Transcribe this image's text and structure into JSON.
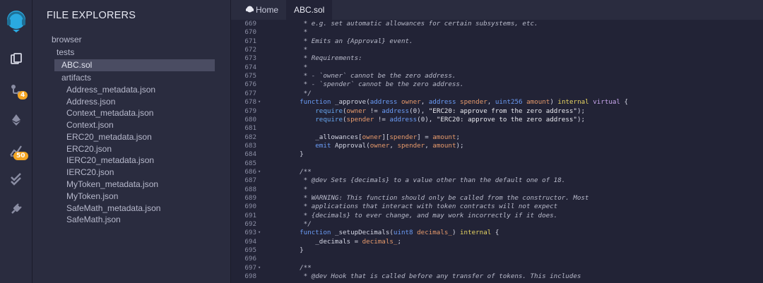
{
  "sidebar": {
    "title": "FILE EXPLORERS",
    "items": [
      {
        "label": "browser"
      },
      {
        "label": "tests"
      },
      {
        "label": "ABC.sol"
      },
      {
        "label": "artifacts"
      },
      {
        "label": "Address_metadata.json"
      },
      {
        "label": "Address.json"
      },
      {
        "label": "Context_metadata.json"
      },
      {
        "label": "Context.json"
      },
      {
        "label": "ERC20_metadata.json"
      },
      {
        "label": "ERC20.json"
      },
      {
        "label": "IERC20_metadata.json"
      },
      {
        "label": "IERC20.json"
      },
      {
        "label": "MyToken_metadata.json"
      },
      {
        "label": "MyToken.json"
      },
      {
        "label": "SafeMath_metadata.json"
      },
      {
        "label": "SafeMath.json"
      }
    ]
  },
  "rail": {
    "badges": {
      "git": "4",
      "analysis": "50"
    },
    "icons": [
      "remix-logo-icon",
      "files-icon",
      "git-icon",
      "deploy-icon",
      "analysis-icon",
      "check-icon",
      "plugin-icon"
    ]
  },
  "tabs": [
    {
      "label": "Home",
      "icon": "remix-home-icon"
    },
    {
      "label": "ABC.sol"
    }
  ],
  "editor": {
    "lines": [
      {
        "n": "669",
        "t": "     * e.g. set automatic allowances for certain subsystems, etc."
      },
      {
        "n": "670",
        "t": "     *"
      },
      {
        "n": "671",
        "t": "     * Emits an {Approval} event."
      },
      {
        "n": "672",
        "t": "     *"
      },
      {
        "n": "673",
        "t": "     * Requirements:"
      },
      {
        "n": "674",
        "t": "     *"
      },
      {
        "n": "675",
        "t": "     * - `owner` cannot be the zero address."
      },
      {
        "n": "676",
        "t": "     * - `spender` cannot be the zero address."
      },
      {
        "n": "677",
        "t": "     */"
      },
      {
        "n": "678",
        "t": "    function _approve(address owner, address spender, uint256 amount) internal virtual {",
        "fold": true
      },
      {
        "n": "679",
        "t": "        require(owner != address(0), \"ERC20: approve from the zero address\");"
      },
      {
        "n": "680",
        "t": "        require(spender != address(0), \"ERC20: approve to the zero address\");"
      },
      {
        "n": "681",
        "t": ""
      },
      {
        "n": "682",
        "t": "        _allowances[owner][spender] = amount;"
      },
      {
        "n": "683",
        "t": "        emit Approval(owner, spender, amount);"
      },
      {
        "n": "684",
        "t": "    }"
      },
      {
        "n": "685",
        "t": ""
      },
      {
        "n": "686",
        "t": "    /**",
        "fold": true
      },
      {
        "n": "687",
        "t": "     * @dev Sets {decimals} to a value other than the default one of 18."
      },
      {
        "n": "688",
        "t": "     *"
      },
      {
        "n": "689",
        "t": "     * WARNING: This function should only be called from the constructor. Most"
      },
      {
        "n": "690",
        "t": "     * applications that interact with token contracts will not expect"
      },
      {
        "n": "691",
        "t": "     * {decimals} to ever change, and may work incorrectly if it does."
      },
      {
        "n": "692",
        "t": "     */"
      },
      {
        "n": "693",
        "t": "    function _setupDecimals(uint8 decimals_) internal {",
        "fold": true
      },
      {
        "n": "694",
        "t": "        _decimals = decimals_;"
      },
      {
        "n": "695",
        "t": "    }"
      },
      {
        "n": "696",
        "t": ""
      },
      {
        "n": "697",
        "t": "    /**",
        "fold": true
      },
      {
        "n": "698",
        "t": "     * @dev Hook that is called before any transfer of tokens. This includes"
      }
    ]
  },
  "colors": {
    "background": "#222336",
    "panel": "#2a2c3f",
    "selected": "#4a4c62",
    "badge": "#f5a623",
    "logo": "#2aa9e0"
  }
}
